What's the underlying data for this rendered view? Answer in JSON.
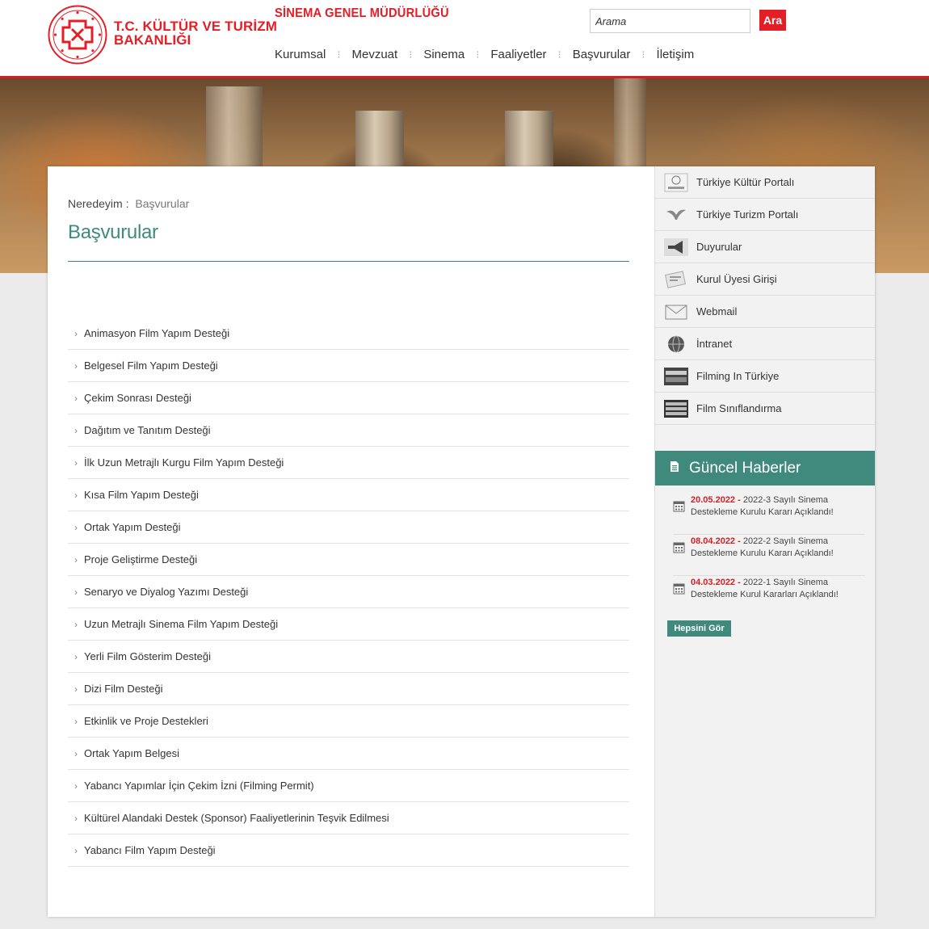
{
  "header": {
    "ministry_line1": "T.C. KÜLTÜR VE TURİZM",
    "ministry_line2": "BAKANLIĞI",
    "directorate": "SİNEMA GENEL MÜDÜRLÜĞÜ",
    "search": {
      "placeholder": "Arama",
      "button": "Ara"
    },
    "nav": [
      "Kurumsal",
      "Mevzuat",
      "Sinema",
      "Faaliyetler",
      "Başvurular",
      "İletişim"
    ]
  },
  "breadcrumb": {
    "label": "Neredeyim :",
    "current": "Başvurular"
  },
  "page_title": "Başvurular",
  "applications": [
    "Animasyon Film Yapım Desteği",
    "Belgesel Film Yapım Desteği",
    "Çekim Sonrası Desteği",
    "Dağıtım ve Tanıtım Desteği",
    "İlk Uzun Metrajlı Kurgu Film Yapım Desteği",
    "Kısa Film Yapım Desteği",
    "Ortak Yapım Desteği",
    "Proje Geliştirme Desteği",
    "Senaryo ve Diyalog Yazımı Desteği",
    "Uzun Metrajlı Sinema Film Yapım Desteği",
    "Yerli Film Gösterim Desteği",
    "Dizi Film Desteği",
    "Etkinlik ve Proje Destekleri",
    "Ortak Yapım Belgesi",
    "Yabancı Yapımlar İçin Çekim İzni (Filming Permit)",
    "Kültürel Alandaki Destek (Sponsor) Faaliyetlerinin Teşvik Edilmesi",
    "Yabancı Film Yapım Desteği"
  ],
  "side_links": [
    {
      "label": "Türkiye Kültür Portalı",
      "icon": "kultur-portal-icon"
    },
    {
      "label": "Türkiye Turizm Portalı",
      "icon": "turizm-portal-icon"
    },
    {
      "label": "Duyurular",
      "icon": "megaphone-icon"
    },
    {
      "label": "Kurul Üyesi Girişi",
      "icon": "login-icon"
    },
    {
      "label": "Webmail",
      "icon": "mail-icon"
    },
    {
      "label": "İntranet",
      "icon": "globe-icon"
    },
    {
      "label": "Filming In Türkiye",
      "icon": "filming-icon"
    },
    {
      "label": "Film Sınıflandırma",
      "icon": "film-rating-icon"
    }
  ],
  "news": {
    "title": "Güncel Haberler",
    "items": [
      {
        "date": "20.05.2022 -",
        "text": "2022-3 Sayılı Sinema Destekleme Kurulu Kararı Açıklandı!"
      },
      {
        "date": "08.04.2022 -",
        "text": "2022-2 Sayılı Sinema Destekleme Kurulu Kararı Açıklandı!"
      },
      {
        "date": "04.03.2022 -",
        "text": "2022-1 Sayılı Sinema Destekleme Kurul Kararları Açıklandı!"
      }
    ],
    "all_button": "Hepsini Gör"
  },
  "colors": {
    "brand_red": "#e41e26",
    "accent_teal": "#3f8a7d"
  }
}
